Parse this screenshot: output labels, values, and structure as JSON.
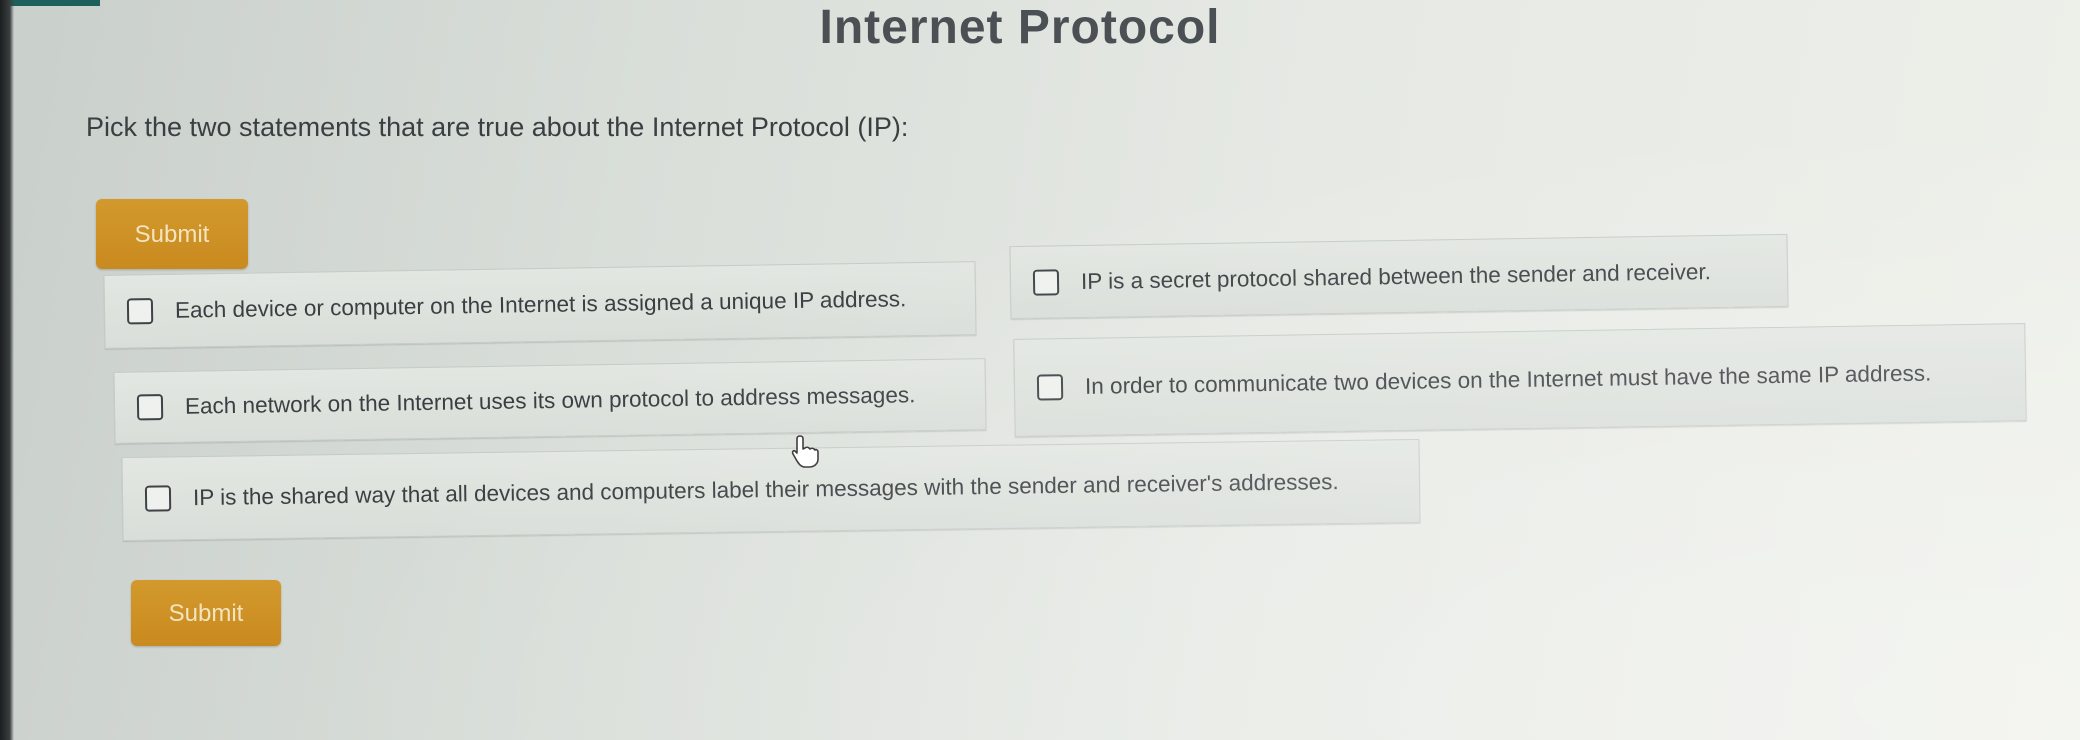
{
  "title": "Internet Protocol",
  "prompt": "Pick the two statements that are true about the Internet Protocol (IP):",
  "submit_label": "Submit",
  "options": [
    {
      "label": "Each device or computer on the Internet is assigned a unique IP address.",
      "checked": false
    },
    {
      "label": "IP is a secret protocol shared between the sender and receiver.",
      "checked": false
    },
    {
      "label": "Each network on the Internet uses its own protocol to address messages.",
      "checked": false
    },
    {
      "label": "In order to communicate two devices on the Internet must have the same IP address.",
      "checked": false
    },
    {
      "label": "IP is the shared way that all devices and computers label their messages with the sender and receiver's addresses.",
      "checked": false
    }
  ],
  "colors": {
    "button": "#cf922a",
    "button_text": "#f3e4c0",
    "background": "#dde2dd",
    "text": "#3a3f42"
  },
  "icons": {
    "checkbox": "checkbox-unchecked-icon",
    "cursor": "hand-pointer-icon"
  }
}
